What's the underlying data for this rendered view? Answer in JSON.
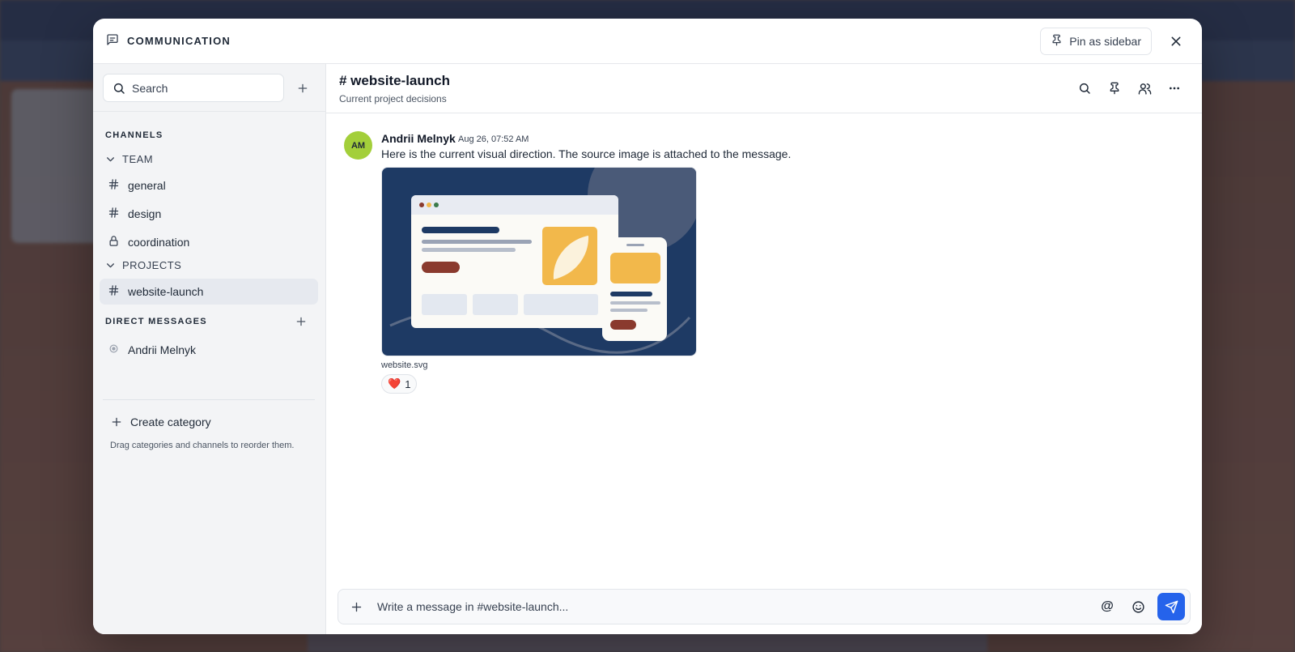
{
  "modal": {
    "title": "COMMUNICATION",
    "pin_label": "Pin as sidebar"
  },
  "sidebar": {
    "search_placeholder": "Search",
    "channels_label": "CHANNELS",
    "categories": [
      {
        "name": "TEAM",
        "channels": [
          {
            "name": "general",
            "icon": "hash-icon"
          },
          {
            "name": "design",
            "icon": "hash-icon"
          },
          {
            "name": "coordination",
            "icon": "lock-icon"
          }
        ]
      },
      {
        "name": "PROJECTS",
        "channels": [
          {
            "name": "website-launch",
            "icon": "hash-icon",
            "active": true
          }
        ]
      }
    ],
    "dm_label": "DIRECT MESSAGES",
    "dms": [
      {
        "name": "Andrii Melnyk"
      }
    ],
    "create_category": "Create category",
    "hint": "Drag categories and channels to reorder them."
  },
  "channel": {
    "name": "# website-launch",
    "description": "Current project decisions"
  },
  "message": {
    "initials": "AM",
    "author": "Andrii Melnyk",
    "time": "Aug 26, 07:52 AM",
    "text": "Here is the current visual direction. The source image is attached to the message.",
    "attachment_name": "website.svg",
    "reaction_emoji": "❤️",
    "reaction_count": "1"
  },
  "composer": {
    "placeholder": "Write a message in #website-launch..."
  },
  "colors": {
    "accent": "#2563eb",
    "avatar": "#a3cf3a"
  }
}
